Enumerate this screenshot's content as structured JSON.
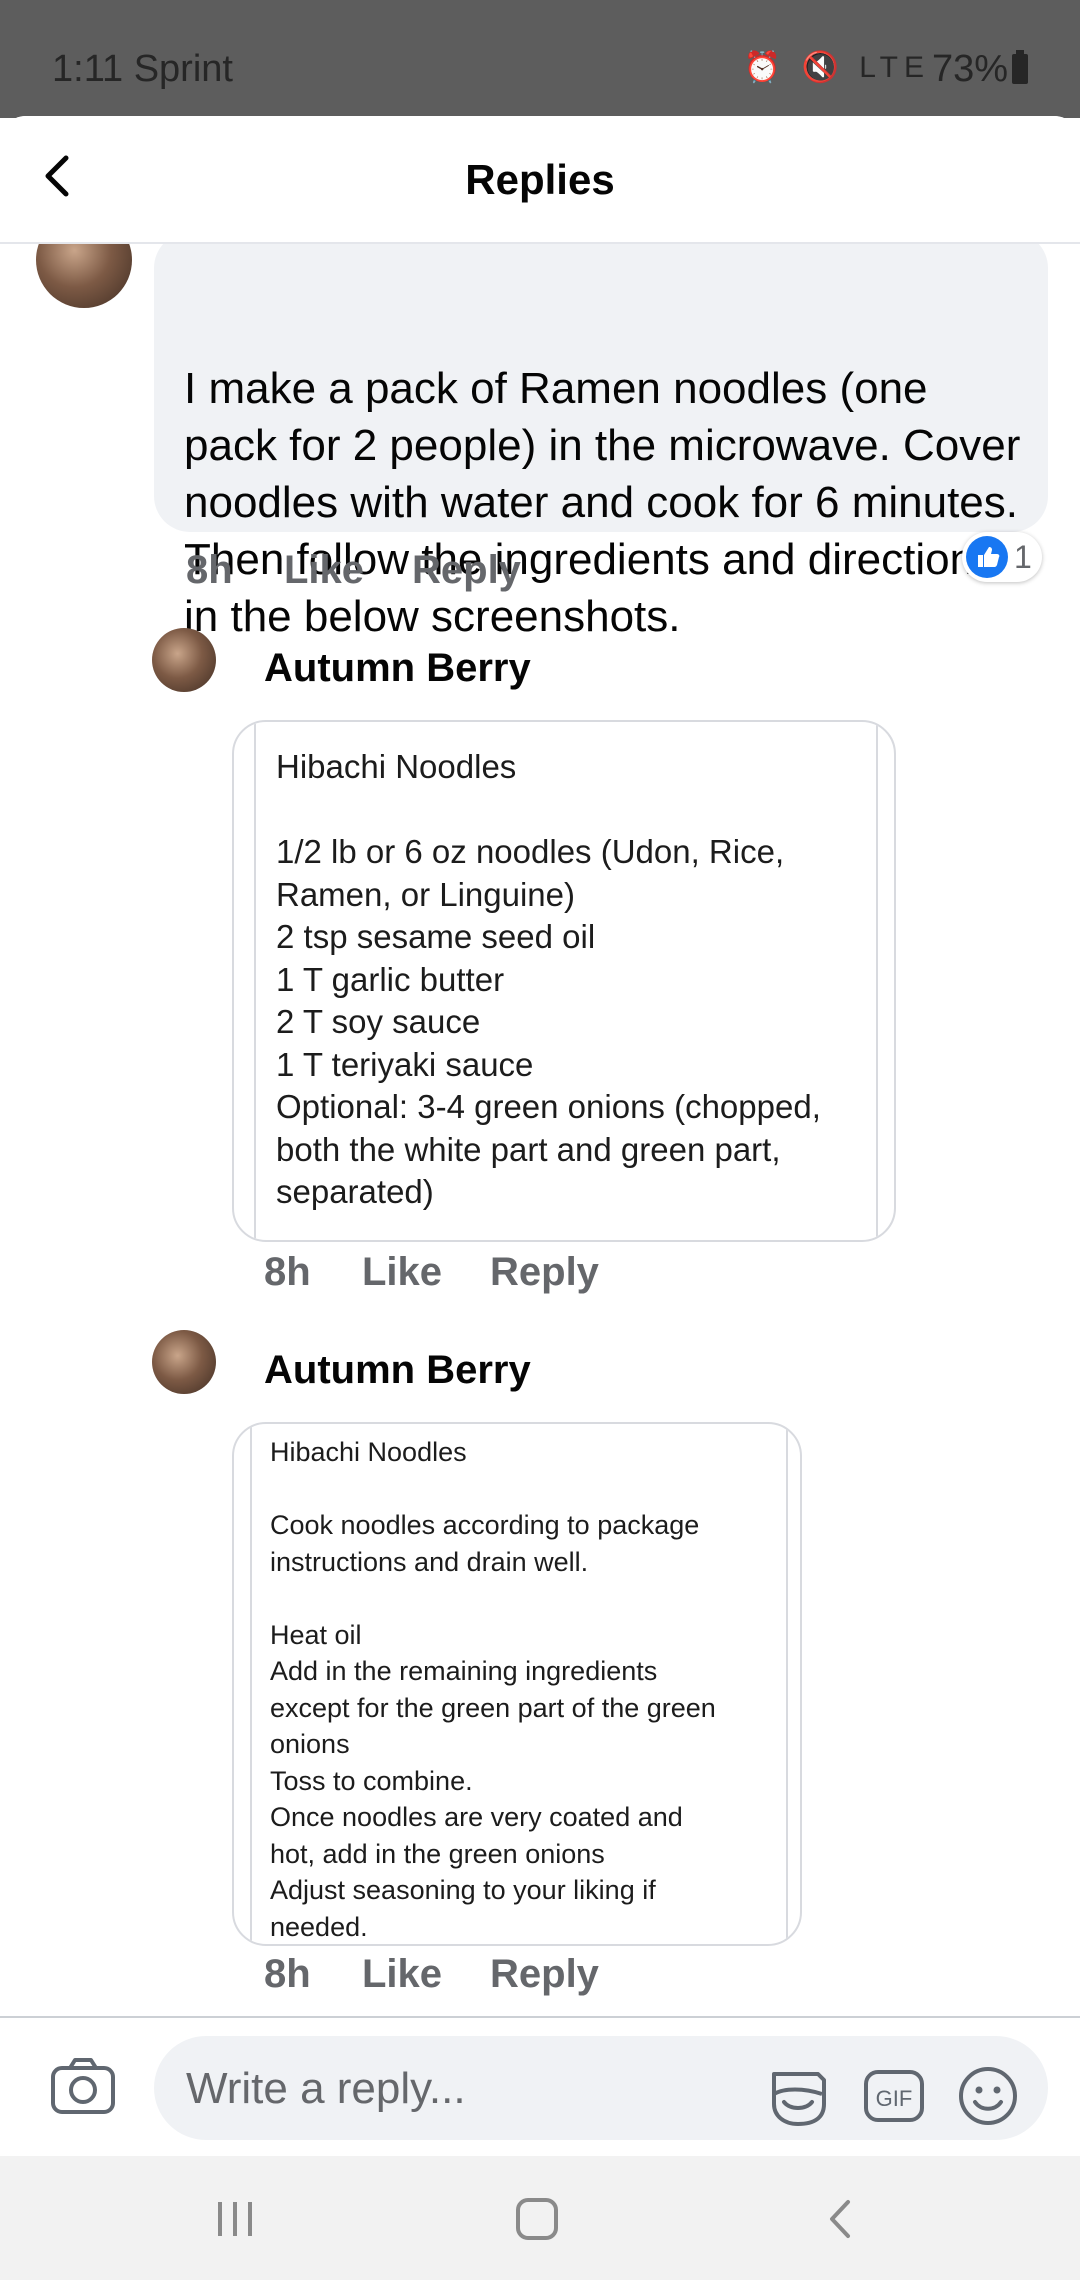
{
  "status_bar": {
    "time_carrier": "1:11 Sprint",
    "icons": "⏰ 🔇 LTE",
    "battery": "73%"
  },
  "header": {
    "title": "Replies"
  },
  "top_comment": {
    "text": "I make a pack of Ramen noodles (one pack for 2 people) in the microwave. Cover noodles with water and cook for 6 minutes. Then follow the ingredients and directions in the below screenshots.",
    "time": "8h",
    "like_label": "Like",
    "reply_label": "Reply",
    "reaction_count": "1"
  },
  "reply1": {
    "author": "Autumn Berry",
    "image_text": "Hibachi Noodles\n\n1/2 lb or 6 oz noodles (Udon, Rice,\nRamen, or Linguine)\n2 tsp sesame seed oil\n1 T garlic butter\n2 T soy sauce\n1 T teriyaki sauce\nOptional: 3-4 green onions (chopped,\nboth the white part and green part,\nseparated)",
    "time": "8h",
    "like_label": "Like",
    "reply_label": "Reply"
  },
  "reply2": {
    "author": "Autumn Berry",
    "image_text": "Hibachi Noodles\n\nCook noodles according to package\ninstructions and drain well.\n\nHeat oil\nAdd in the remaining ingredients\nexcept for the green part of the green\nonions\nToss to combine.\nOnce noodles are very coated and\nhot, add in the green onions\nAdjust seasoning to your liking if\nneeded.",
    "time": "8h",
    "like_label": "Like",
    "reply_label": "Reply"
  },
  "composer": {
    "placeholder": "Write a reply...",
    "gif_label": "GIF"
  },
  "colors": {
    "accent": "#1877f2",
    "bubble": "#f0f2f5",
    "meta": "#65676b"
  }
}
